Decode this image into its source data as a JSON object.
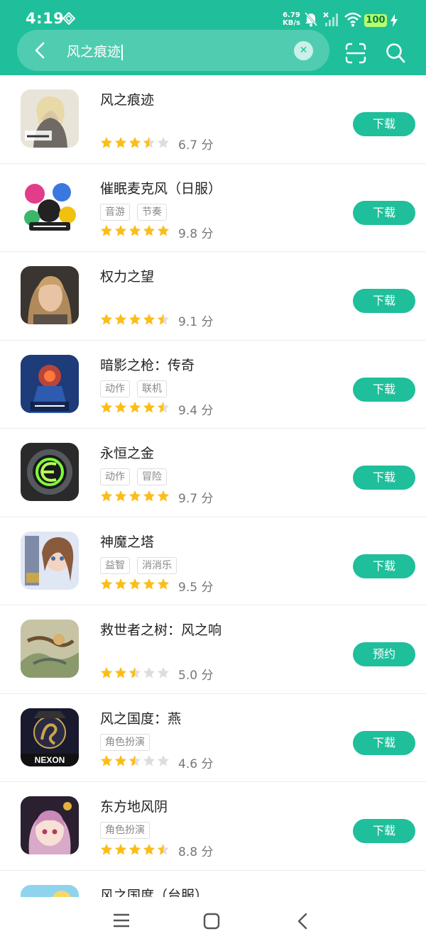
{
  "status_bar": {
    "time": "4:19",
    "speed_value": "6.79",
    "speed_unit": "KB/s",
    "battery": "100"
  },
  "search": {
    "query": "风之痕迹",
    "clear_icon": "close-icon"
  },
  "results": [
    {
      "name": "风之痕迹",
      "tags": [],
      "rating": 3.5,
      "score": "6.7 分",
      "action": "下载",
      "icon": "game-icon-fengzhi"
    },
    {
      "name": "催眠麦克风（日服）",
      "tags": [
        "音游",
        "节奏"
      ],
      "rating": 5,
      "score": "9.8 分",
      "action": "下载",
      "icon": "game-icon-hypnosis"
    },
    {
      "name": "权力之望",
      "tags": [],
      "rating": 4.5,
      "score": "9.1 分",
      "action": "下载",
      "icon": "game-icon-quanli"
    },
    {
      "name": "暗影之枪：传奇",
      "tags": [
        "动作",
        "联机"
      ],
      "rating": 4.5,
      "score": "9.4 分",
      "action": "下载",
      "icon": "game-icon-shadowgun"
    },
    {
      "name": "永恒之金",
      "tags": [
        "动作",
        "冒险"
      ],
      "rating": 5,
      "score": "9.7 分",
      "action": "下载",
      "icon": "game-icon-yongheng"
    },
    {
      "name": "神魔之塔",
      "tags": [
        "益智",
        "消消乐"
      ],
      "rating": 5,
      "score": "9.5 分",
      "action": "下载",
      "icon": "game-icon-shenmo"
    },
    {
      "name": "救世者之树：风之响",
      "tags": [],
      "rating": 2.5,
      "score": "5.0 分",
      "action": "预约",
      "icon": "game-icon-jiushizhe"
    },
    {
      "name": "风之国度：燕",
      "tags": [
        "角色扮演"
      ],
      "rating": 2.5,
      "score": "4.6 分",
      "action": "下载",
      "icon": "game-icon-nexon"
    },
    {
      "name": "东方地风阴",
      "tags": [
        "角色扮演"
      ],
      "rating": 4.5,
      "score": "8.8 分",
      "action": "下载",
      "icon": "game-icon-dongfang"
    },
    {
      "name": "风之国度（台服）",
      "tags": [],
      "rating": 0,
      "score": "",
      "action": "",
      "icon": "game-icon-fengzhiguodu-tw"
    }
  ],
  "colors": {
    "accent": "#1fbf9b",
    "star_on": "#fbbd19",
    "star_off": "#dddddd"
  }
}
